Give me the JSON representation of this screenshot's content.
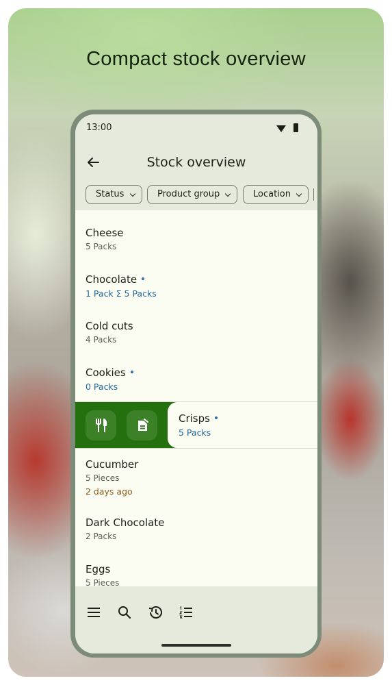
{
  "headline": "Compact stock overview",
  "status_bar": {
    "time": "13:00",
    "wifi_icon": "wifi-icon",
    "battery_icon": "battery-icon"
  },
  "app_bar": {
    "title": "Stock overview",
    "back_icon": "arrow-back-icon"
  },
  "filters": [
    {
      "label": "Status"
    },
    {
      "label": "Product group"
    },
    {
      "label": "Location"
    }
  ],
  "items": [
    {
      "name": "Cheese",
      "amount": "5 Packs",
      "highlight": false
    },
    {
      "name": "Chocolate",
      "amount": "1 Pack  Σ 5 Packs",
      "highlight": true
    },
    {
      "name": "Cold cuts",
      "amount": "4 Packs",
      "highlight": false
    },
    {
      "name": "Cookies",
      "amount": "0 Packs",
      "highlight": true
    },
    {
      "name": "Crisps",
      "amount": "5 Packs",
      "highlight": true,
      "swiped": true
    },
    {
      "name": "Cucumber",
      "amount": "5 Pieces",
      "due": "2 days ago",
      "highlight": false
    },
    {
      "name": "Dark Chocolate",
      "amount": "2 Packs",
      "highlight": false
    },
    {
      "name": "Eggs",
      "amount": "5 Pieces",
      "highlight": false
    }
  ],
  "swipe_actions": [
    {
      "icon": "consume-fork-knife-icon"
    },
    {
      "icon": "open-package-icon"
    }
  ],
  "bottom_nav": [
    {
      "icon": "menu-icon"
    },
    {
      "icon": "search-icon"
    },
    {
      "icon": "history-icon"
    },
    {
      "icon": "list-numbered-icon"
    }
  ],
  "colors": {
    "accent_green": "#24700f",
    "action_button": "#3c8128",
    "link_blue": "#256a9b",
    "due_brown": "#8a5c1e",
    "surface": "#fbfcf2",
    "surface_variant": "#e5eadc"
  }
}
